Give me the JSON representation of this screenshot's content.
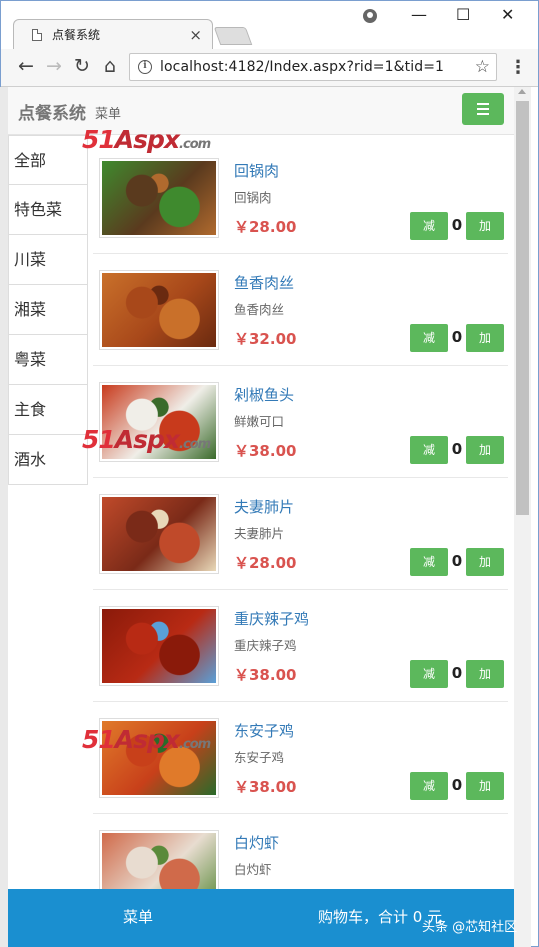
{
  "browser": {
    "tab_title": "点餐系统",
    "tab_close": "×",
    "url": "localhost:4182/Index.aspx?rid=1&tid=1",
    "minimize": "—",
    "maximize": "☐",
    "close": "✕",
    "back": "←",
    "forward": "→",
    "reload": "↻",
    "home": "⌂",
    "star": "☆",
    "menu": "⋮",
    "info": "i"
  },
  "header": {
    "brand": "点餐系统",
    "subtitle": "菜单"
  },
  "watermark": {
    "a": "51",
    "b": "Aspx",
    "c": ".com"
  },
  "categories": [
    "全部",
    "特色菜",
    "川菜",
    "湘菜",
    "粤菜",
    "主食",
    "酒水"
  ],
  "dishes": [
    {
      "name": "回锅肉",
      "desc": "回锅肉",
      "price": "￥28.00",
      "qty": "0",
      "minus": "减",
      "plus": "加",
      "img_colors": [
        "#5a3a1e",
        "#3f8a2e",
        "#b06a2e"
      ]
    },
    {
      "name": "鱼香肉丝",
      "desc": "鱼香肉丝",
      "price": "￥32.00",
      "qty": "0",
      "minus": "减",
      "plus": "加",
      "img_colors": [
        "#a8481a",
        "#c9702a",
        "#6a2a10"
      ]
    },
    {
      "name": "剁椒鱼头",
      "desc": "鲜嫩可口",
      "price": "￥38.00",
      "qty": "0",
      "minus": "减",
      "plus": "加",
      "img_colors": [
        "#f0eee8",
        "#c83a1c",
        "#3a6a2a"
      ]
    },
    {
      "name": "夫妻肺片",
      "desc": "夫妻肺片",
      "price": "￥28.00",
      "qty": "0",
      "minus": "减",
      "plus": "加",
      "img_colors": [
        "#7a2a18",
        "#c04a2a",
        "#e8d8b8"
      ]
    },
    {
      "name": "重庆辣子鸡",
      "desc": "重庆辣子鸡",
      "price": "￥38.00",
      "qty": "0",
      "minus": "减",
      "plus": "加",
      "img_colors": [
        "#b82a14",
        "#8a1a0a",
        "#5aa0d8"
      ]
    },
    {
      "name": "东安子鸡",
      "desc": "东安子鸡",
      "price": "￥38.00",
      "qty": "0",
      "minus": "减",
      "plus": "加",
      "img_colors": [
        "#c8401a",
        "#e07a2a",
        "#2a6a2a"
      ]
    },
    {
      "name": "白灼虾",
      "desc": "白灼虾",
      "price": "",
      "qty": "",
      "minus": "",
      "plus": "",
      "img_colors": [
        "#e8dcd0",
        "#d06a4a",
        "#5a8a3a"
      ]
    }
  ],
  "footer": {
    "menu": "菜单",
    "cart": "购物车，合计 0 元",
    "credit": "头条 @芯知社区"
  }
}
